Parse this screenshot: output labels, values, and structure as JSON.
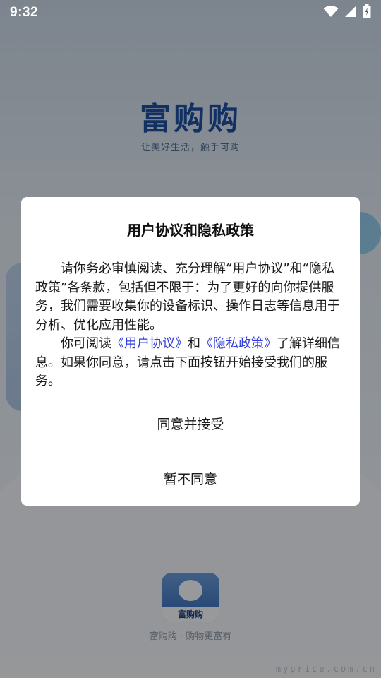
{
  "status_bar": {
    "time": "9:32",
    "icons": [
      "wifi-icon",
      "cellular-signal-icon",
      "battery-charging-icon"
    ]
  },
  "splash": {
    "title": "富购购",
    "slogan": "让美好生活，触手可购",
    "app_icon_label": "富购购",
    "bottom_caption": "富购购 · 购物更富有",
    "watermark": "myprice.com.cn"
  },
  "dialog": {
    "title": "用户协议和隐私政策",
    "paragraph1": "请你务必审慎阅读、充分理解“用户协议”和“隐私政策”各条款，包括但不限于：为了更好的向你提供服务，我们需要收集你的设备标识、操作日志等信息用于分析、优化应用性能。",
    "paragraph2_prefix": "你可阅读",
    "user_agreement_link": "《用户协议》",
    "paragraph2_and": "和",
    "privacy_policy_link": "《隐私政策》",
    "paragraph2_suffix": "了解详细信息。如果你同意，请点击下面按钮开始接受我们的服务。",
    "accept_label": "同意并接受",
    "decline_label": "暂不同意"
  },
  "colors": {
    "link": "#2f3bd8",
    "brand_blue": "#1d4f9e",
    "overlay": "rgba(0,0,0,0.38)"
  }
}
